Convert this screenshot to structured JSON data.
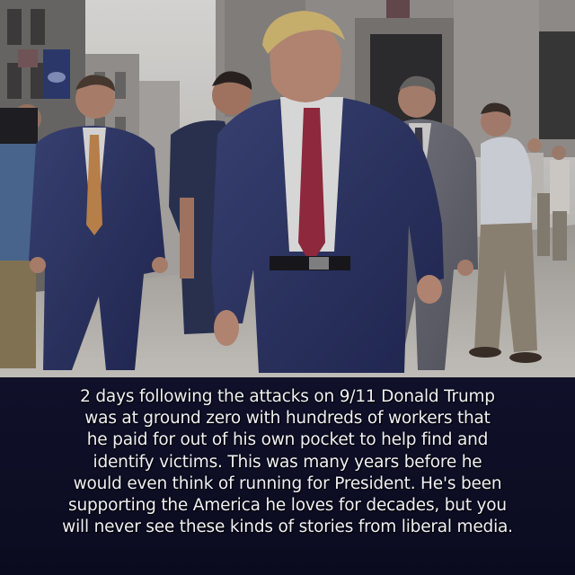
{
  "meme": {
    "caption_lines": [
      "2 days following the attacks on 9/11 Donald Trump",
      "was at ground zero with hundreds of workers that",
      "he paid for out of his own pocket to help find and",
      "identify victims. This was many years before he",
      "would even think of running for President. He's been",
      "supporting the America he loves for decades, but you",
      "will never see these kinds of stories from liberal media."
    ]
  },
  "photo": {
    "scene": "street scene with men in suits walking",
    "colors": {
      "street": "#b9b6ae",
      "building": "#8d8a84",
      "suit_navy": "#2c3566",
      "suit_grey": "#6c6d74",
      "tie_red": "#9a2a3e",
      "tie_gold": "#c88a4a",
      "caption_bg": "#0c0c1e",
      "caption_text": "#eef0f6"
    }
  }
}
